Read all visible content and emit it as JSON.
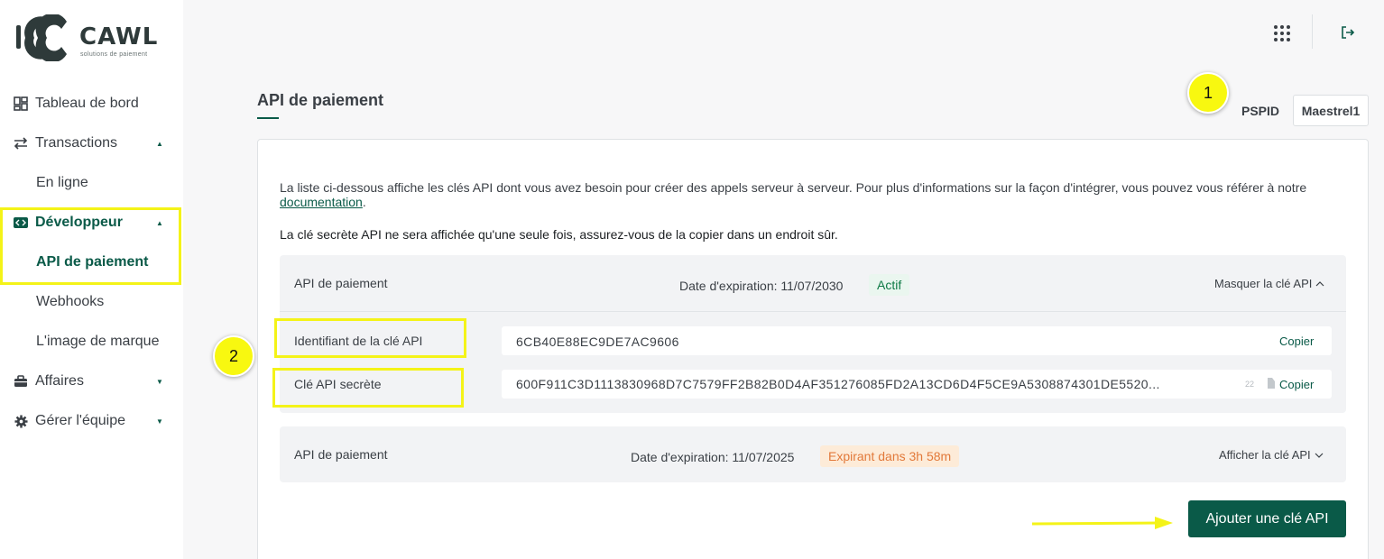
{
  "brand": {
    "name": "CAWL",
    "tagline": "solutions de paiement"
  },
  "sidebar": {
    "items": [
      {
        "label": "Tableau de bord",
        "icon": "dashboard-icon"
      },
      {
        "label": "Transactions",
        "icon": "swap-arrows-icon"
      },
      {
        "label": "En ligne"
      },
      {
        "label": "Développeur",
        "icon": "code-icon"
      },
      {
        "label": "API de paiement"
      },
      {
        "label": "Webhooks"
      },
      {
        "label": "L'image de marque"
      },
      {
        "label": "Affaires",
        "icon": "briefcase-icon"
      },
      {
        "label": "Gérer l'équipe",
        "icon": "gear-icon"
      }
    ]
  },
  "header": {
    "title": "API de paiement",
    "pspid_label": "PSPID",
    "pspid_value": "Maestrel1"
  },
  "annotations": {
    "badge1": "1",
    "badge2": "2"
  },
  "content": {
    "intro_text": "La liste ci-dessous affiche les clés API dont vous avez besoin pour créer des appels serveur à serveur. Pour plus d'informations sur la façon d'intégrer, vous pouvez vous référer à notre ",
    "doc_link": "documentation",
    "intro_end": ".",
    "warning": "La clé secrète API ne sera affichée qu'une seule fois, assurez-vous de la copier dans un endroit sûr."
  },
  "keys": [
    {
      "name": "API de paiement",
      "expiry": "Date d'expiration: 11/07/2030",
      "status": "Actif",
      "toggle": "Masquer la clé API",
      "id_label": "Identifiant de la clé API",
      "id_value": "6CB40E88EC9DE7AC9606",
      "secret_label": "Clé API secrète",
      "secret_value": "600F911C3D1113830968D7C7579FF2B82B0D4AF351276085FD2A13CD6D4F5CE9A5308874301DE5520...",
      "secret_count": "22",
      "copy_label": "Copier"
    },
    {
      "name": "API de paiement",
      "expiry": "Date d'expiration: 11/07/2025",
      "status": "Expirant dans 3h 58m",
      "toggle": "Afficher la clé API"
    }
  ],
  "actions": {
    "add_key": "Ajouter une clé API"
  },
  "colors": {
    "brand_green": "#0a5a48",
    "highlight_yellow": "#f4f318",
    "active_green": "#0e7a45",
    "expiring_orange": "#e2793a"
  }
}
